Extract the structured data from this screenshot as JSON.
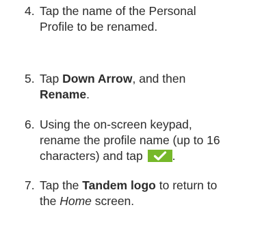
{
  "steps": [
    {
      "number": "4.",
      "lines": [
        "Tap the name of the Personal",
        "Profile to be renamed."
      ]
    },
    {
      "number": "5.",
      "tap": "Tap ",
      "down_arrow": "Down Arrow",
      "and_then": ", and then",
      "rename": "Rename",
      "period": "."
    },
    {
      "number": "6.",
      "line1": "Using the on-screen keypad,",
      "line2": "rename the profile name (up to 16",
      "line3_text": "characters) and tap ",
      "line3_end": ".",
      "confirm_icon": "checkmark-icon",
      "confirm_color": "#76b82a"
    },
    {
      "number": "7.",
      "tap": "Tap the ",
      "logo": "Tandem logo",
      "return_to": " to return to",
      "the": "the ",
      "home": "Home",
      "screen": " screen."
    }
  ]
}
